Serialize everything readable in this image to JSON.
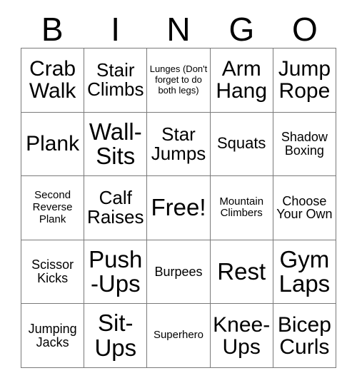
{
  "card": {
    "title_letters": [
      "B",
      "I",
      "N",
      "G",
      "O"
    ],
    "columns": 5,
    "rows": 5,
    "free_space_label": "Free!",
    "colors": {
      "background": "#ffffff",
      "text": "#000000",
      "grid_line": "#7a7a7a"
    },
    "cells": [
      {
        "text": "Crab Walk",
        "size": "xl"
      },
      {
        "text": "Stair Climbs",
        "size": "lg"
      },
      {
        "text": "Lunges (Don't forget to do both legs)",
        "size": "xxs"
      },
      {
        "text": "Arm Hang",
        "size": "xl"
      },
      {
        "text": "Jump Rope",
        "size": "xl"
      },
      {
        "text": "Plank",
        "size": "xl"
      },
      {
        "text": "Wall-Sits",
        "size": "xxl"
      },
      {
        "text": "Star Jumps",
        "size": "lg"
      },
      {
        "text": "Squats",
        "size": "md"
      },
      {
        "text": "Shadow Boxing",
        "size": "sm"
      },
      {
        "text": "Second Reverse Plank",
        "size": "xs"
      },
      {
        "text": "Calf Raises",
        "size": "lg"
      },
      {
        "text": "Free!",
        "size": "xxl"
      },
      {
        "text": "Mountain Climbers",
        "size": "xs"
      },
      {
        "text": "Choose Your Own",
        "size": "sm"
      },
      {
        "text": "Scissor Kicks",
        "size": "sm"
      },
      {
        "text": "Push-Ups",
        "size": "xxl"
      },
      {
        "text": "Burpees",
        "size": "sm"
      },
      {
        "text": "Rest",
        "size": "xxl"
      },
      {
        "text": "Gym Laps",
        "size": "xxl"
      },
      {
        "text": "Jumping Jacks",
        "size": "sm"
      },
      {
        "text": "Sit-Ups",
        "size": "xxl"
      },
      {
        "text": "Superhero",
        "size": "xs"
      },
      {
        "text": "Knee-Ups",
        "size": "xl"
      },
      {
        "text": "Bicep Curls",
        "size": "xl"
      }
    ]
  }
}
